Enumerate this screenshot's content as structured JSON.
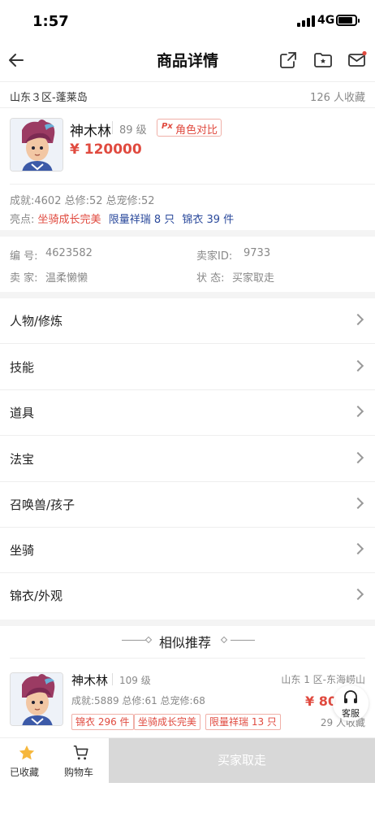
{
  "status_bar": {
    "time": "1:57",
    "network": "4G"
  },
  "nav": {
    "title": "商品详情"
  },
  "server": {
    "name": "山东３区-蓬莱岛",
    "favorites": "126 人收藏"
  },
  "item": {
    "name": "神木林",
    "level": "89 级",
    "compare_label": "角色对比",
    "compare_icon_text": "Px",
    "price": "¥ 120000",
    "stats": "成就:4602 总修:52 总宠修:52",
    "highlight_prefix": "亮点:",
    "highlights": [
      "坐骑成长完美",
      "限量祥瑞 8 只",
      "锦衣 39 件"
    ]
  },
  "info": {
    "id_label": "编 号:",
    "id_value": "4623582",
    "seller_id_label": "卖家ID:",
    "seller_id_value": "9733",
    "seller_label": "卖 家:",
    "seller_value": "温柔懒懒",
    "state_label": "状 态:",
    "state_value": "买家取走"
  },
  "menu": [
    {
      "label": "人物/修炼"
    },
    {
      "label": "技能"
    },
    {
      "label": "道具"
    },
    {
      "label": "法宝"
    },
    {
      "label": "召唤兽/孩子"
    },
    {
      "label": "坐骑"
    },
    {
      "label": "锦衣/外观"
    }
  ],
  "similar": {
    "title": "相似推荐",
    "item": {
      "name": "神木林",
      "level": "109 级",
      "server": "山东 1 区-东海崂山",
      "stats": "成就:5889 总修:61 总宠修:68",
      "price": "¥ 80",
      "favorites": "29 人收藏",
      "tags": [
        "锦衣 296 件",
        "坐骑成长完美",
        "限量祥瑞 13 只"
      ]
    },
    "service_label": "客服"
  },
  "bottom_bar": {
    "favorited_label": "已收藏",
    "cart_label": "购物车",
    "buy_label": "买家取走"
  },
  "colors": {
    "accent": "#e04a3f",
    "navy": "#2b4a9c",
    "star": "#f6b73c"
  }
}
